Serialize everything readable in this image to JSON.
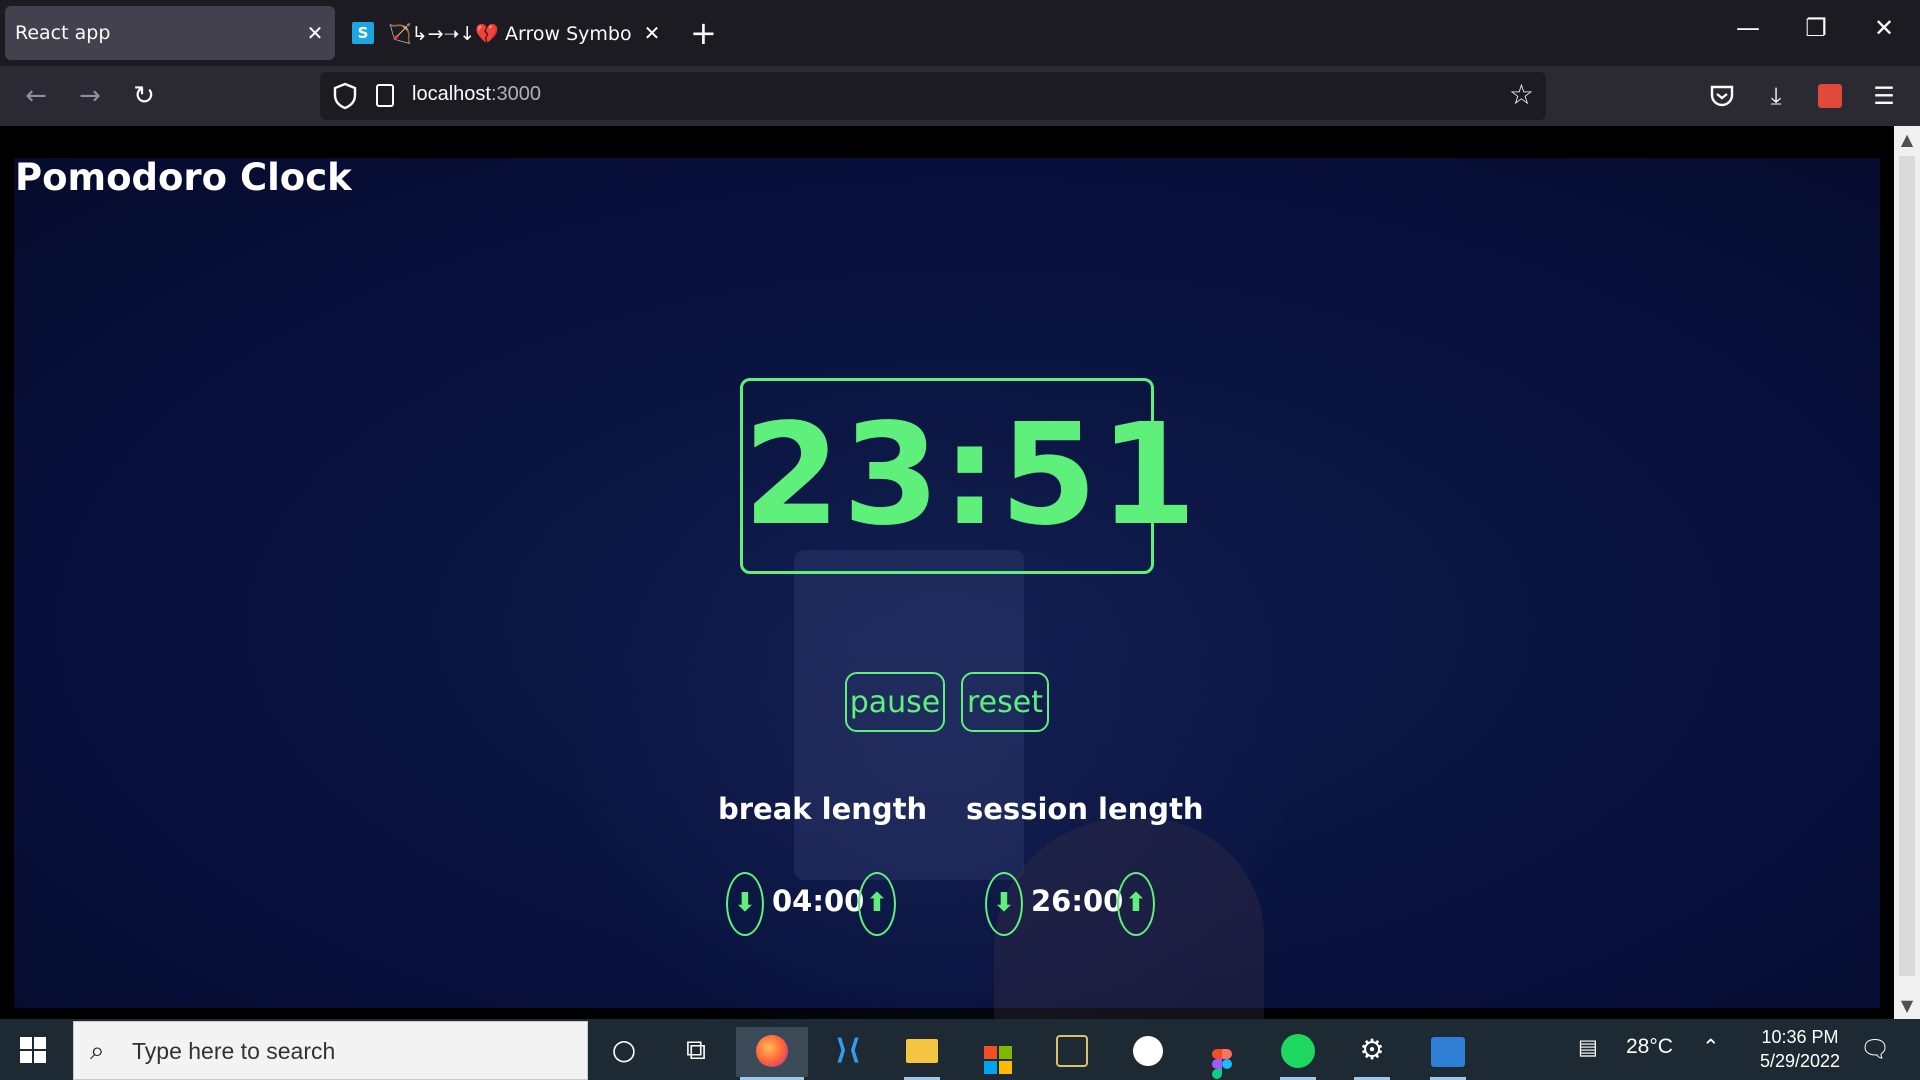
{
  "browser": {
    "tabs": [
      {
        "label": "React app",
        "active": true
      },
      {
        "label": "🏹↳→➝↓💔 Arrow Symbol: Up",
        "active": false
      }
    ],
    "favicon_glyph": "S",
    "new_tab": "+",
    "close_glyph": "✕",
    "url_host": "localhost",
    "url_port": ":3000",
    "window_controls": {
      "minimize": "—",
      "restore": "❐",
      "close": "✕"
    }
  },
  "app": {
    "title": "Pomodoro Clock",
    "timer": "23:51",
    "pause_label": "pause",
    "reset_label": "reset",
    "break": {
      "label": "break length",
      "value": "04:00",
      "down": "⬇",
      "up": "⬆"
    },
    "session": {
      "label": "session length",
      "value": "26:00",
      "down": "⬇",
      "up": "⬆"
    }
  },
  "colors": {
    "accent": "#5ef07a",
    "background": "#07103a"
  },
  "taskbar": {
    "search_placeholder": "Type here to search",
    "apps": [
      "cortana-icon",
      "task-view-icon",
      "firefox-icon",
      "vscode-icon",
      "file-explorer-icon",
      "microsoft-store-icon",
      "app-icon",
      "whatsapp-icon",
      "figma-icon",
      "spotify-icon",
      "settings-icon",
      "media-player-icon"
    ],
    "weather": "28°C",
    "time": "10:36 PM",
    "date": "5/29/2022"
  }
}
